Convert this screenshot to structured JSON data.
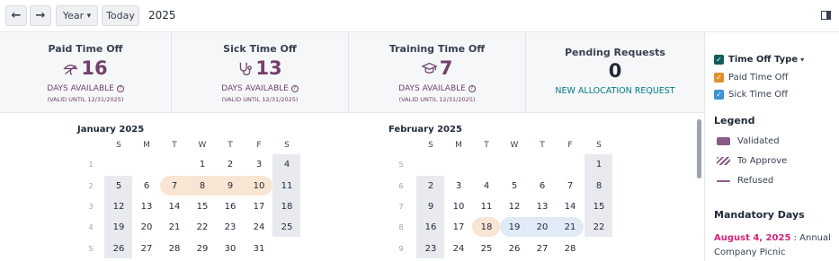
{
  "toolbar": {
    "prev_label": "←",
    "next_label": "→",
    "scale_label": "Year",
    "scale_caret": "▾",
    "today_label": "Today",
    "current_label": "2025"
  },
  "summary": {
    "cards": [
      {
        "title": "Paid Time Off",
        "value": "16",
        "icon": "umbrella-icon",
        "days": "DAYS AVAILABLE",
        "valid": "(VALID UNTIL 12/31/2025)"
      },
      {
        "title": "Sick Time Off",
        "value": "13",
        "icon": "stethoscope-icon",
        "days": "DAYS AVAILABLE",
        "valid": "(VALID UNTIL 12/31/2025)"
      },
      {
        "title": "Training Time Off",
        "value": "7",
        "icon": "graduation-cap-icon",
        "days": "DAYS AVAILABLE",
        "valid": "(VALID UNTIL 12/31/2025)"
      }
    ],
    "pending": {
      "title": "Pending Requests",
      "value": "0",
      "link": "NEW ALLOCATION REQUEST"
    },
    "help_glyph": "?"
  },
  "calendar": {
    "weekday_labels": [
      "S",
      "M",
      "T",
      "W",
      "T",
      "F",
      "S"
    ],
    "months": [
      {
        "title": "January 2025",
        "weeks": [
          {
            "wk": "1",
            "days": [
              "",
              "",
              "",
              "1",
              "2",
              "3",
              "4"
            ]
          },
          {
            "wk": "2",
            "days": [
              "5",
              "6",
              "7",
              "8",
              "9",
              "10",
              "11"
            ]
          },
          {
            "wk": "3",
            "days": [
              "12",
              "13",
              "14",
              "15",
              "16",
              "17",
              "18"
            ]
          },
          {
            "wk": "4",
            "days": [
              "19",
              "20",
              "21",
              "22",
              "23",
              "24",
              "25"
            ]
          },
          {
            "wk": "5",
            "days": [
              "26",
              "27",
              "28",
              "29",
              "30",
              "31",
              ""
            ]
          }
        ]
      },
      {
        "title": "February 2025",
        "weeks": [
          {
            "wk": "5",
            "days": [
              "",
              "",
              "",
              "",
              "",
              "",
              "1"
            ]
          },
          {
            "wk": "6",
            "days": [
              "2",
              "3",
              "4",
              "5",
              "6",
              "7",
              "8"
            ]
          },
          {
            "wk": "7",
            "days": [
              "9",
              "10",
              "11",
              "12",
              "13",
              "14",
              "15"
            ]
          },
          {
            "wk": "8",
            "days": [
              "16",
              "17",
              "18",
              "19",
              "20",
              "21",
              "22"
            ]
          },
          {
            "wk": "9",
            "days": [
              "23",
              "24",
              "25",
              "26",
              "27",
              "28",
              ""
            ]
          }
        ]
      }
    ]
  },
  "sidebar": {
    "filters": [
      {
        "label": "Time Off Type",
        "caret": "▾",
        "color": "#0f5e57",
        "bold": true
      },
      {
        "label": "Paid Time Off",
        "color": "#e0912f",
        "bold": false
      },
      {
        "label": "Sick Time Off",
        "color": "#3b93d3",
        "bold": false
      }
    ],
    "check_glyph": "✓",
    "legend_title": "Legend",
    "legend": [
      {
        "label": "Validated",
        "style": "solid",
        "color": "#8a5a86"
      },
      {
        "label": "To Approve",
        "style": "striped",
        "color": "#8a5a86"
      },
      {
        "label": "Refused",
        "style": "line",
        "color": "#8a5a86"
      }
    ],
    "mandatory_title": "Mandatory Days",
    "mandatory_date": "August 4, 2025",
    "mandatory_text": " : Annual Company Picnic"
  },
  "colors": {
    "accent": "#71416b",
    "link": "#017e84",
    "mandatory_date": "#d6247a",
    "highlight_orange": "#f9e5d3",
    "highlight_blue": "#e1ebf6",
    "weekend_bg": "#e8eaef"
  }
}
